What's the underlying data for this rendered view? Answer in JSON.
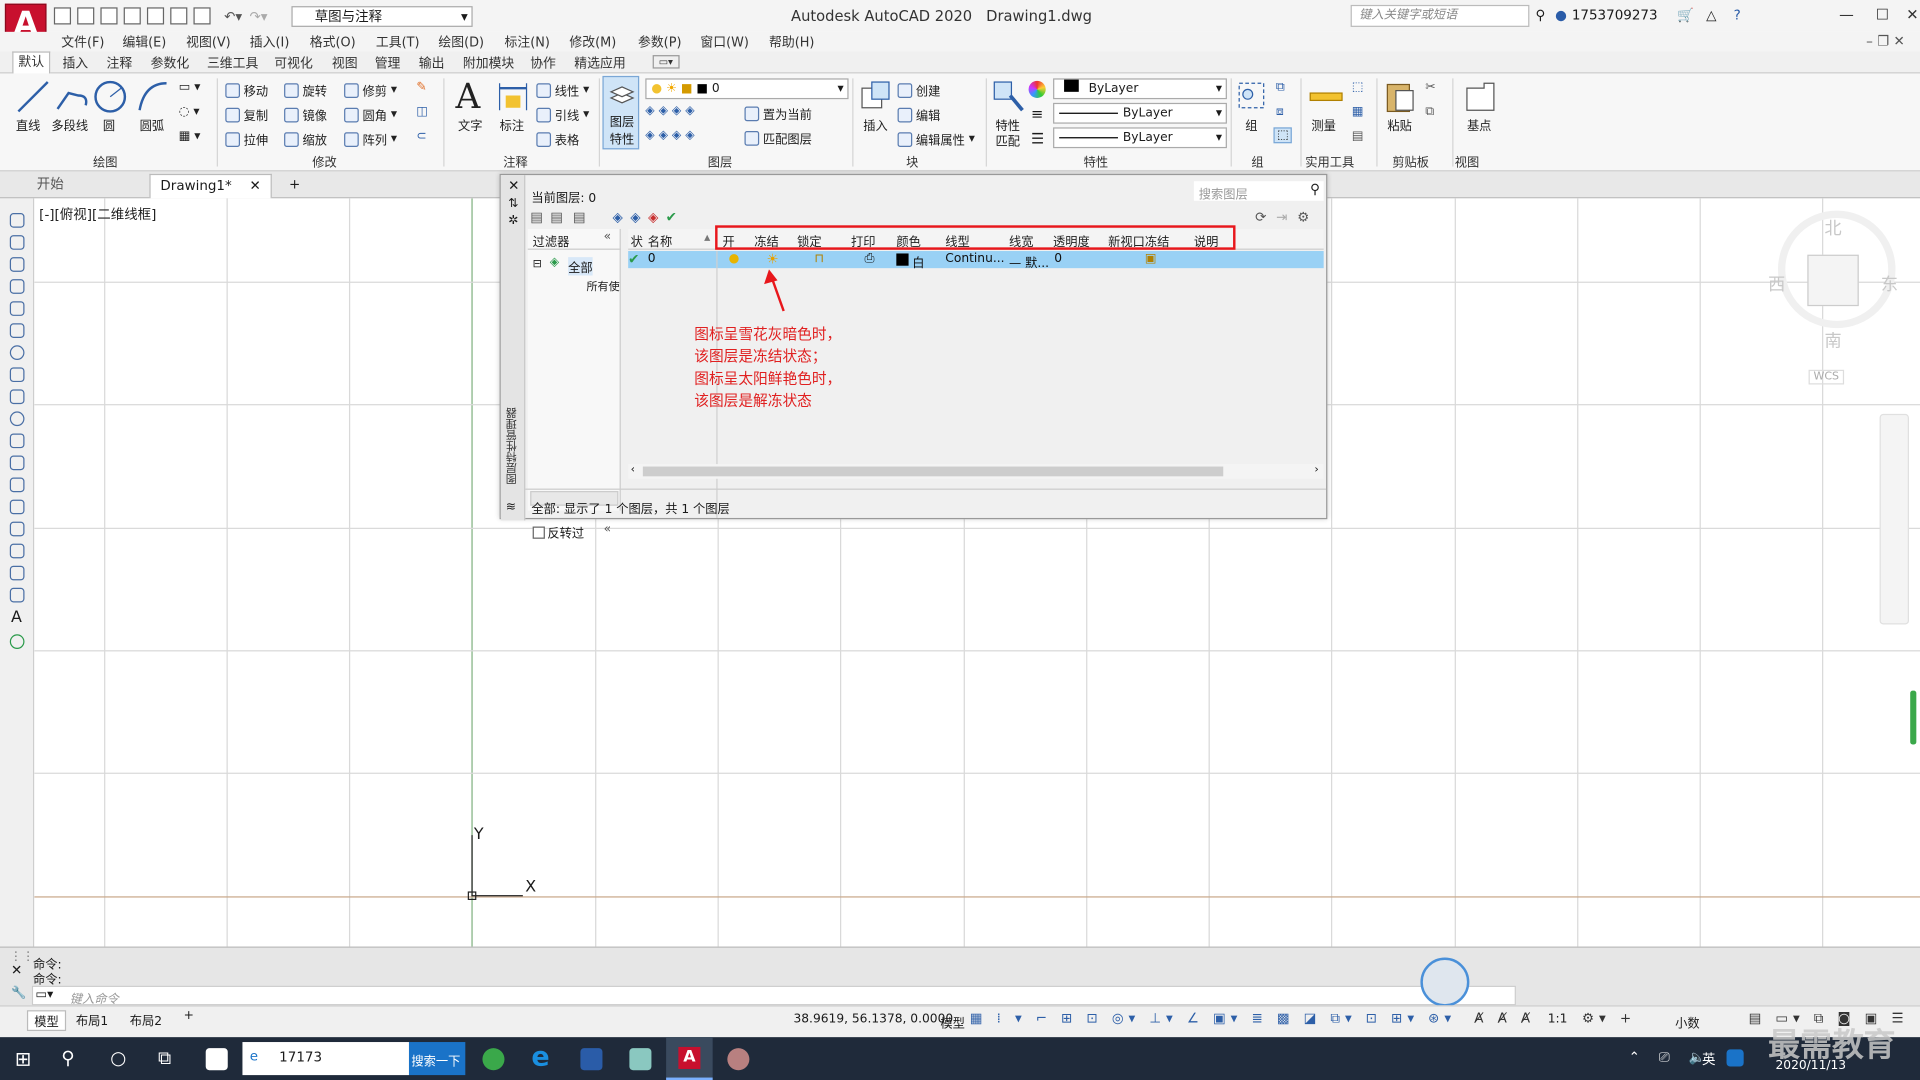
{
  "window": {
    "app_title": "Autodesk AutoCAD 2020",
    "file_title": "Drawing1.dwg",
    "workspace": "草图与注释",
    "help_search_placeholder": "键入关键字或短语",
    "user": "1753709273",
    "logo_letter": "A"
  },
  "menus": [
    "文件(F)",
    "编辑(E)",
    "视图(V)",
    "插入(I)",
    "格式(O)",
    "工具(T)",
    "绘图(D)",
    "标注(N)",
    "修改(M)",
    "参数(P)",
    "窗口(W)",
    "帮助(H)"
  ],
  "ribbon_tabs": [
    "默认",
    "插入",
    "注释",
    "参数化",
    "三维工具",
    "可视化",
    "视图",
    "管理",
    "输出",
    "附加模块",
    "协作",
    "精选应用"
  ],
  "ribbon": {
    "draw": {
      "label": "绘图",
      "line": "直线",
      "polyline": "多段线",
      "circle": "圆",
      "arc": "圆弧"
    },
    "modify": {
      "label": "修改",
      "move": "移动",
      "rotate": "旋转",
      "trim": "修剪",
      "copy": "复制",
      "mirror": "镜像",
      "fillet": "圆角",
      "stretch": "拉伸",
      "scale": "缩放",
      "array": "阵列"
    },
    "annotation": {
      "label": "注释",
      "text": "文字",
      "dimension": "标注",
      "linear": "线性",
      "leader": "引线",
      "table": "表格"
    },
    "layers": {
      "label": "图层",
      "properties_line1": "图层",
      "properties_line2": "特性",
      "current_layer": "0",
      "make_current": "置为当前",
      "match_layer": "匹配图层"
    },
    "block": {
      "label": "块",
      "insert": "插入",
      "create": "创建",
      "edit": "编辑",
      "edit_attributes": "编辑属性"
    },
    "properties": {
      "label": "特性",
      "match_line1": "特性",
      "match_line2": "匹配",
      "color": "ByLayer",
      "linetype": "ByLayer",
      "lineweight": "ByLayer"
    },
    "groups": {
      "label": "组",
      "group": "组"
    },
    "utilities": {
      "label": "实用工具",
      "measure": "测量"
    },
    "clipboard": {
      "label": "剪贴板",
      "paste": "粘贴"
    },
    "view": {
      "label": "视图",
      "base": "基点"
    }
  },
  "doc_tabs": {
    "start": "开始",
    "drawing": "Drawing1*",
    "add": "+"
  },
  "viewport_label": "[-][俯视][二维线框]",
  "viewcube": {
    "north": "北",
    "south": "南",
    "east": "东",
    "west": "西",
    "wcs": "WCS"
  },
  "axes": {
    "x": "X",
    "y": "Y"
  },
  "layer_palette": {
    "current_layer_label": "当前图层: 0",
    "search_placeholder": "搜索图层",
    "filters_header": "过滤器",
    "filter_all": "全部",
    "filter_used": "所有使",
    "invert_filter": "反转过",
    "columns": [
      "状",
      "名称",
      "开",
      "冻结",
      "锁定",
      "打印",
      "颜色",
      "线型",
      "线宽",
      "透明度",
      "新视口冻结",
      "说明"
    ],
    "rows": [
      {
        "name": "0",
        "color": "白",
        "linetype": "Continu...",
        "lineweight": "— 默...",
        "transparency": "0"
      }
    ],
    "status_text": "全部: 显示了 1 个图层，共 1 个图层",
    "side_title": "图层特性管理器"
  },
  "annotation_lines": [
    "图标呈雪花灰暗色时，",
    "该图层是冻结状态；",
    "图标呈太阳鲜艳色时，",
    "该图层是解冻状态"
  ],
  "command": {
    "history": [
      "命令:",
      "命令:"
    ],
    "placeholder": "键入命令"
  },
  "layout_tabs": [
    "模型",
    "布局1",
    "布局2",
    "+"
  ],
  "status": {
    "coords": "38.9619, 56.1378, 0.0000",
    "model": "模型",
    "scale": "1:1",
    "units": "小数"
  },
  "taskbar": {
    "search_text": "17173",
    "search_button": "搜索一下",
    "ime": "英",
    "date": "2020/11/13",
    "watermark": "最需教育"
  },
  "colors": {
    "accent": "#c8102e",
    "selection": "#99d1f5",
    "highlight_red": "#e8171c",
    "taskbar": "#1f2a3a"
  }
}
